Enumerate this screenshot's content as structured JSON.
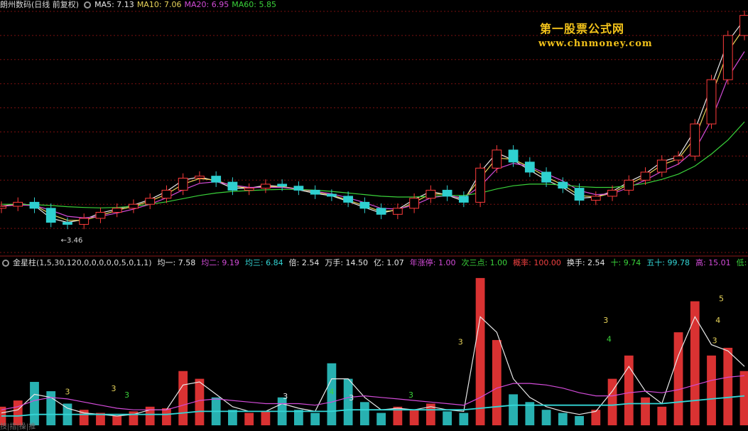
{
  "header": {
    "title": "朗州数码(日线 前复权)",
    "ma_labels": [
      {
        "text": "MA5: 7.13",
        "color": "#e8e8e8"
      },
      {
        "text": "MA10: 7.06",
        "color": "#e8d45a"
      },
      {
        "text": "MA20: 6.95",
        "color": "#d24bd8"
      },
      {
        "text": "MA60: 5.85",
        "color": "#3ad23a"
      }
    ]
  },
  "watermark": {
    "line1": "第一股票公式网",
    "line2": "www.chnmoney.com"
  },
  "indicator_header": {
    "name": "金星柱(1,5,30,120,0,0,0,0,0,5,0,1,1)",
    "items": [
      {
        "text": "均一: 7.58",
        "color": "#e8e8e8"
      },
      {
        "text": "均二: 9.19",
        "color": "#d24bd8"
      },
      {
        "text": "均三: 6.84",
        "color": "#33d6d6"
      },
      {
        "text": "倍: 2.54",
        "color": "#e8e8e8"
      },
      {
        "text": "万手: 14.50",
        "color": "#e8e8e8"
      },
      {
        "text": "亿: 1.07",
        "color": "#e8e8e8"
      },
      {
        "text": "年涨停: 1.00",
        "color": "#d24bd8"
      },
      {
        "text": "次三点: 1.00",
        "color": "#3ad23a"
      },
      {
        "text": "概率: 100.00",
        "color": "#f04040"
      },
      {
        "text": "换手: 2.54",
        "color": "#e8e8e8"
      },
      {
        "text": "十: 9.74",
        "color": "#3ad23a"
      },
      {
        "text": "五十: 99.78",
        "color": "#33d6d6"
      },
      {
        "text": "高: 15.01",
        "color": "#d24bd8"
      },
      {
        "text": "低: 13.64",
        "color": "#3ad23a"
      }
    ]
  },
  "bottom_tag": "技|指|操|推",
  "colors": {
    "up": "#ff3b3b",
    "down": "#2fd0d0",
    "ma5": "#e8e8e8",
    "ma10": "#e8d45a",
    "ma20": "#d24bd8",
    "ma60": "#3ad23a",
    "grid": "#7a1010",
    "separator": "#8a1a1a",
    "vol_line1": "#e8e8e8",
    "vol_line2": "#d24bd8",
    "vol_line3": "#33d6d6"
  },
  "chart_data": [
    {
      "type": "line",
      "title": "朗州数码(日线 前复权)",
      "ylim": [
        3.0,
        9.0
      ],
      "grid": true,
      "x": [
        0,
        5,
        10,
        15,
        20,
        25,
        30,
        35,
        40,
        45,
        50,
        55,
        60,
        65,
        70,
        75,
        80,
        85,
        90,
        95,
        100,
        105,
        110,
        115,
        120,
        125,
        130,
        135,
        140,
        145,
        150,
        155,
        160,
        165,
        170,
        175,
        180,
        185,
        190,
        195,
        200,
        205,
        210,
        215,
        220,
        225
      ],
      "close": [
        4.15,
        4.25,
        4.1,
        3.75,
        3.7,
        3.85,
        4.0,
        4.1,
        4.2,
        4.35,
        4.55,
        4.85,
        4.9,
        4.75,
        4.55,
        4.6,
        4.7,
        4.65,
        4.55,
        4.45,
        4.4,
        4.25,
        4.1,
        3.95,
        4.1,
        4.35,
        4.55,
        4.4,
        4.25,
        5.1,
        5.55,
        5.25,
        5.0,
        4.75,
        4.6,
        4.3,
        4.4,
        4.55,
        4.8,
        5.0,
        5.3,
        5.4,
        6.2,
        7.3,
        8.4,
        8.9
      ],
      "series": [
        {
          "name": "MA5",
          "values": [
            4.15,
            4.22,
            4.17,
            3.85,
            3.75,
            3.82,
            3.98,
            4.08,
            4.18,
            4.32,
            4.52,
            4.8,
            4.88,
            4.78,
            4.6,
            4.6,
            4.67,
            4.64,
            4.56,
            4.47,
            4.41,
            4.27,
            4.12,
            3.98,
            4.07,
            4.32,
            4.52,
            4.43,
            4.28,
            5.0,
            5.48,
            5.3,
            5.05,
            4.8,
            4.62,
            4.35,
            4.38,
            4.52,
            4.76,
            4.96,
            5.26,
            5.38,
            6.05,
            7.15,
            8.25,
            8.8
          ]
        },
        {
          "name": "MA10",
          "values": [
            4.15,
            4.2,
            4.18,
            3.95,
            3.8,
            3.8,
            3.92,
            4.05,
            4.15,
            4.28,
            4.45,
            4.7,
            4.84,
            4.8,
            4.65,
            4.6,
            4.64,
            4.64,
            4.58,
            4.5,
            4.43,
            4.3,
            4.16,
            4.02,
            4.05,
            4.25,
            4.46,
            4.45,
            4.32,
            4.85,
            5.35,
            5.32,
            5.12,
            4.88,
            4.68,
            4.42,
            4.38,
            4.48,
            4.7,
            4.9,
            5.18,
            5.33,
            5.85,
            6.9,
            8.0,
            8.6
          ]
        },
        {
          "name": "MA20",
          "values": [
            4.15,
            4.18,
            4.17,
            4.05,
            3.9,
            3.86,
            3.9,
            3.98,
            4.08,
            4.2,
            4.36,
            4.56,
            4.72,
            4.76,
            4.68,
            4.62,
            4.62,
            4.62,
            4.58,
            4.52,
            4.46,
            4.36,
            4.24,
            4.1,
            4.08,
            4.18,
            4.36,
            4.42,
            4.36,
            4.65,
            5.08,
            5.22,
            5.14,
            4.96,
            4.78,
            4.54,
            4.44,
            4.46,
            4.62,
            4.8,
            5.02,
            5.2,
            5.55,
            6.3,
            7.35,
            8.0
          ]
        },
        {
          "name": "MA60",
          "values": [
            4.2,
            4.2,
            4.19,
            4.17,
            4.14,
            4.12,
            4.11,
            4.12,
            4.15,
            4.2,
            4.26,
            4.34,
            4.42,
            4.48,
            4.52,
            4.54,
            4.56,
            4.57,
            4.57,
            4.55,
            4.52,
            4.48,
            4.44,
            4.4,
            4.38,
            4.38,
            4.4,
            4.42,
            4.42,
            4.48,
            4.58,
            4.66,
            4.7,
            4.7,
            4.68,
            4.64,
            4.62,
            4.62,
            4.66,
            4.72,
            4.82,
            4.95,
            5.15,
            5.45,
            5.8,
            6.25
          ]
        }
      ],
      "annotations": [
        {
          "x": 18,
          "y": 3.46,
          "text": "←3.46"
        }
      ]
    },
    {
      "type": "bar",
      "ylim": [
        0,
        100
      ],
      "x": [
        0,
        5,
        10,
        15,
        20,
        25,
        30,
        35,
        40,
        45,
        50,
        55,
        60,
        65,
        70,
        75,
        80,
        85,
        90,
        95,
        100,
        105,
        110,
        115,
        120,
        125,
        130,
        135,
        140,
        145,
        150,
        155,
        160,
        165,
        170,
        175,
        180,
        185,
        190,
        195,
        200,
        205,
        210,
        215,
        220,
        225
      ],
      "values": [
        12,
        16,
        28,
        22,
        14,
        10,
        8,
        6,
        9,
        12,
        11,
        35,
        30,
        18,
        10,
        8,
        9,
        18,
        10,
        8,
        40,
        30,
        15,
        8,
        12,
        10,
        14,
        9,
        8,
        95,
        55,
        20,
        15,
        10,
        8,
        6,
        10,
        30,
        45,
        18,
        12,
        60,
        80,
        45,
        50,
        35
      ],
      "series": [
        {
          "name": "均一",
          "values": [
            8,
            10,
            20,
            18,
            11,
            8,
            7,
            6,
            7,
            10,
            10,
            26,
            28,
            20,
            12,
            9,
            9,
            14,
            11,
            9,
            30,
            30,
            18,
            10,
            11,
            10,
            12,
            10,
            9,
            70,
            60,
            30,
            18,
            12,
            9,
            7,
            9,
            22,
            38,
            22,
            14,
            45,
            70,
            52,
            48,
            38
          ]
        },
        {
          "name": "均二",
          "values": [
            10,
            12,
            16,
            18,
            17,
            15,
            13,
            11,
            10,
            10,
            10,
            13,
            16,
            17,
            16,
            15,
            14,
            14,
            14,
            13,
            15,
            18,
            19,
            18,
            17,
            16,
            15,
            14,
            13,
            18,
            24,
            27,
            27,
            26,
            24,
            21,
            19,
            19,
            21,
            22,
            21,
            23,
            26,
            29,
            31,
            32
          ]
        },
        {
          "name": "均三",
          "values": [
            6,
            6,
            7,
            7,
            7,
            7,
            7,
            7,
            7,
            7,
            7,
            8,
            9,
            9,
            9,
            9,
            9,
            9,
            9,
            9,
            9,
            10,
            10,
            10,
            10,
            10,
            10,
            10,
            10,
            11,
            12,
            13,
            13,
            13,
            13,
            13,
            13,
            13,
            14,
            14,
            14,
            15,
            16,
            17,
            18,
            19
          ]
        }
      ],
      "labels": [
        {
          "x": 20,
          "y": 20,
          "text": "3",
          "color": "#e8d45a"
        },
        {
          "x": 34,
          "y": 22,
          "text": "3",
          "color": "#e8d45a"
        },
        {
          "x": 38,
          "y": 18,
          "text": "3",
          "color": "#3ad23a"
        },
        {
          "x": 86,
          "y": 17,
          "text": "3",
          "color": "#e8e8e8"
        },
        {
          "x": 100,
          "y": 20,
          "text": "4",
          "color": "#3ad23a"
        },
        {
          "x": 106,
          "y": 16,
          "text": "3",
          "color": "#e8e8e8"
        },
        {
          "x": 124,
          "y": 18,
          "text": "3",
          "color": "#3ad23a"
        },
        {
          "x": 139,
          "y": 52,
          "text": "3",
          "color": "#e8d45a"
        },
        {
          "x": 183,
          "y": 66,
          "text": "3",
          "color": "#e8d45a"
        },
        {
          "x": 184,
          "y": 54,
          "text": "4",
          "color": "#3ad23a"
        },
        {
          "x": 218,
          "y": 80,
          "text": "5",
          "color": "#e8d45a"
        },
        {
          "x": 217,
          "y": 66,
          "text": "4",
          "color": "#e8d45a"
        },
        {
          "x": 216,
          "y": 53,
          "text": "3",
          "color": "#e8d45a"
        }
      ]
    }
  ]
}
